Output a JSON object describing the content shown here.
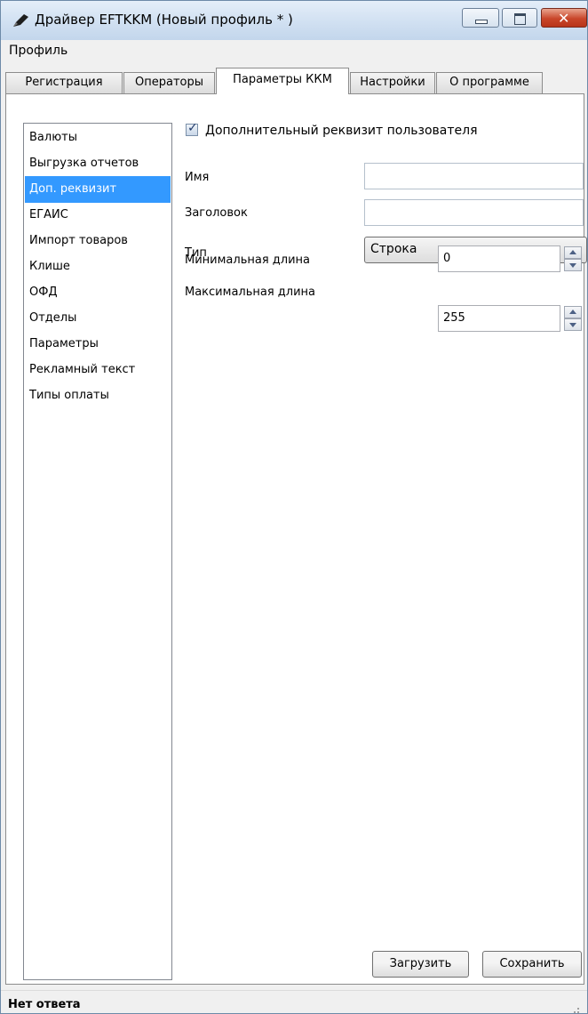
{
  "window": {
    "title": "Драйвер EFTKKM (Новый профиль * )"
  },
  "menu": {
    "items": [
      "Профиль"
    ]
  },
  "tabs": [
    {
      "label": "Регистрация",
      "active": false
    },
    {
      "label": "Операторы",
      "active": false
    },
    {
      "label": "Параметры ККМ",
      "active": true
    },
    {
      "label": "Настройки",
      "active": false
    },
    {
      "label": "О программе",
      "active": false
    }
  ],
  "sidebar": {
    "selected_index": 2,
    "items": [
      {
        "label": "Валюты"
      },
      {
        "label": "Выгрузка отчетов"
      },
      {
        "label": "Доп. реквизит"
      },
      {
        "label": "ЕГАИС"
      },
      {
        "label": "Импорт товаров"
      },
      {
        "label": "Клише"
      },
      {
        "label": "ОФД"
      },
      {
        "label": "Отделы"
      },
      {
        "label": "Параметры"
      },
      {
        "label": "Рекламный текст"
      },
      {
        "label": "Типы оплаты"
      }
    ]
  },
  "form": {
    "user_requisite": {
      "label": "Дополнительный реквизит пользователя",
      "checked": true
    },
    "name": {
      "label": "Имя",
      "value": ""
    },
    "header": {
      "label": "Заголовок",
      "value": ""
    },
    "type": {
      "label": "Тип",
      "value": "Строка"
    },
    "min_length": {
      "label": "Минимальная длина",
      "value": "0"
    },
    "max_length": {
      "label": "Максимальная длина",
      "value": "255"
    }
  },
  "buttons": {
    "load": "Загрузить",
    "save": "Сохранить"
  },
  "status": {
    "text": "Нет ответа"
  },
  "colors": {
    "selection": "#3399ff",
    "close_button": "#c9462a"
  },
  "icons": {
    "app": "pen-icon",
    "minimize": "minimize-icon",
    "maximize": "maximize-icon",
    "close": "close-icon"
  }
}
